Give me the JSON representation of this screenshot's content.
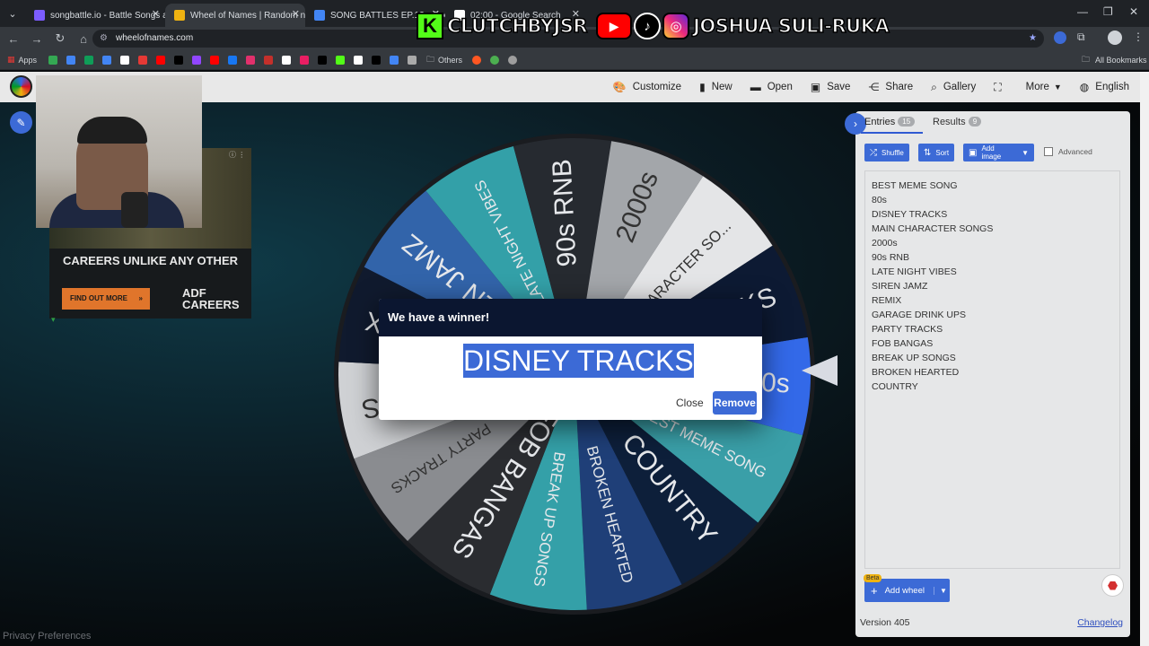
{
  "browser": {
    "tabs": [
      {
        "title": "songbattle.io - Battle Songs ag",
        "favicon_color": "#7b5cff",
        "active": false
      },
      {
        "title": "Wheel of Names | Random nam",
        "favicon_color": "#eeb211",
        "active": true
      },
      {
        "title": "SONG BATTLES EP.12 - Goo",
        "favicon_color": "#4285f4",
        "active": false
      },
      {
        "title": "02:00 - Google Search",
        "favicon_color": "#ffffff",
        "active": false
      }
    ],
    "url": "wheelofnames.com",
    "bookmarks": {
      "apps_label": "Apps",
      "others_label": "Others",
      "all_bookmarks_label": "All Bookmarks",
      "icon_colors": [
        "#34a853",
        "#4285f4",
        "#0f9d58",
        "#4285f4",
        "#ffffff",
        "#e53935",
        "#ff0000",
        "#000000",
        "#9146ff",
        "#ff0000",
        "#1877f2",
        "#e1306c",
        "#c4302b",
        "#ffffff",
        "#e91e63",
        "#000000",
        "#53fc18",
        "#ffffff",
        "#000000",
        "#4285f4",
        "#aaaaaa"
      ],
      "tail_icon_colors": [
        "#ff5722",
        "#4caf50",
        "#9e9e9e"
      ]
    }
  },
  "stream_overlay": {
    "kick_letter": "K",
    "kick_handle": "CLUTCHBYJSR",
    "social_handle": "JOSHUA SULI-RUKA"
  },
  "site_menu": {
    "customize": "Customize",
    "new": "New",
    "open": "Open",
    "save": "Save",
    "share": "Share",
    "gallery": "Gallery",
    "more": "More",
    "language": "English"
  },
  "ad": {
    "headline": "CAREERS UNLIKE ANY OTHER",
    "button": "FIND OUT MORE",
    "logo_line1": "ADF",
    "logo_line2": "CAREERS"
  },
  "wheel": {
    "rotation_deg": -9,
    "segments": [
      {
        "label": "80s",
        "color": "#3369e8"
      },
      {
        "label": "BEST MEME SONG",
        "color": "#3a9fa8"
      },
      {
        "label": "COUNTRY",
        "color": "#0d1f3a"
      },
      {
        "label": "BROKEN HEARTED",
        "color": "#1f3f78"
      },
      {
        "label": "BREAK UP SONGS",
        "color": "#34a0a8"
      },
      {
        "label": "FOB BANGAS",
        "color": "#2a2c30"
      },
      {
        "label": "PARTY TRACKS",
        "color": "#8a8c90"
      },
      {
        "label": "K UPS",
        "color": "#cfd1d4"
      },
      {
        "label": "EMIX",
        "color": "#101a2e"
      },
      {
        "label": "SIREN JAMZ",
        "color": "#3264aa"
      },
      {
        "label": "LATE NIGHT VIBES",
        "color": "#33a0a8"
      },
      {
        "label": "90s RNB",
        "color": "#262a30"
      },
      {
        "label": "2000s",
        "color": "#a3a6aa"
      },
      {
        "label": "CHARACTER SO...",
        "color": "#e4e5e7"
      },
      {
        "label": "ACKS",
        "color": "#0d1a33"
      }
    ]
  },
  "panel": {
    "entries_label": "Entries",
    "entries_count": "15",
    "results_label": "Results",
    "results_count": "9",
    "shuffle": "Shuffle",
    "sort": "Sort",
    "add_image": "Add image",
    "advanced": "Advanced",
    "entries": [
      "BEST MEME SONG",
      "80s",
      "DISNEY TRACKS",
      "MAIN CHARACTER SONGS",
      "2000s",
      "90s RNB",
      "LATE NIGHT VIBES",
      "SIREN JAMZ",
      "REMIX",
      "GARAGE DRINK UPS",
      "PARTY TRACKS",
      "FOB BANGAS",
      "BREAK UP SONGS",
      "BROKEN HEARTED",
      "COUNTRY"
    ],
    "beta": "Beta",
    "add_wheel": "Add wheel",
    "version": "Version 405",
    "changelog": "Changelog"
  },
  "modal": {
    "title": "We have a winner!",
    "winner": "DISNEY TRACKS",
    "close": "Close",
    "remove": "Remove"
  },
  "footer": {
    "privacy": "Privacy Preferences"
  }
}
